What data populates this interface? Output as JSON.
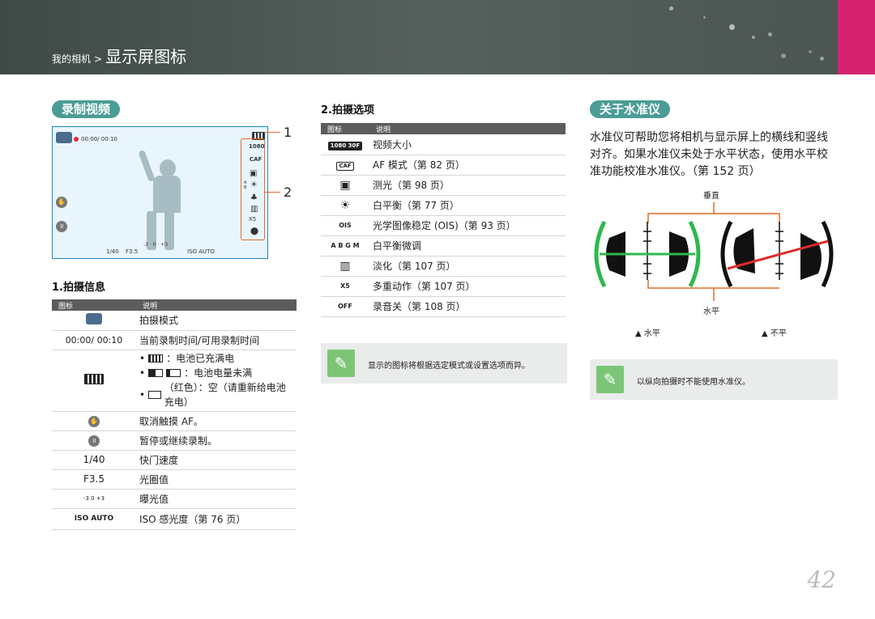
{
  "breadcrumb": {
    "parent": "我的相机",
    "sep": ">",
    "current": "显示屏图标"
  },
  "left": {
    "pill": "录制视频",
    "screen": {
      "time": "00:00/ 00:10",
      "shutter": "1/40",
      "aperture": "F3.5",
      "iso": "ISO AUTO"
    },
    "callouts": [
      "1",
      "2"
    ],
    "section_title": "1.拍摄信息",
    "table_headers": [
      "图标",
      "说明"
    ],
    "rows": [
      {
        "icon": "smart-mode-icon",
        "desc": "拍摄模式"
      },
      {
        "icon_text": "00:00/ 00:10",
        "desc": "当前录制时间/可用录制时间"
      },
      {
        "icon": "battery-icon",
        "bullets": [
          {
            "sym": "full",
            "text": "：电池已充满电"
          },
          {
            "sym": "half",
            "text": "：电池电量未满"
          },
          {
            "sym": "empty",
            "text": "（红色）：空（请重新给电池充电）"
          }
        ]
      },
      {
        "icon": "touch-af-icon",
        "desc": "取消触摸 AF。"
      },
      {
        "icon": "pause-icon",
        "desc": "暂停或继续录制。"
      },
      {
        "icon_text": "1/40",
        "desc": "快门速度"
      },
      {
        "icon_text": "F3.5",
        "desc": "光圈值"
      },
      {
        "icon_text": "-3 0 +3",
        "desc": "曝光值"
      },
      {
        "icon_text": "ISO AUTO",
        "desc": "ISO 感光度（第 76 页）"
      }
    ]
  },
  "middle": {
    "section_title": "2.拍摄选项",
    "table_headers": [
      "图标",
      "说明"
    ],
    "rows": [
      {
        "icon": "movie-size-icon",
        "icon_text": "1080 30F",
        "desc": "视频大小"
      },
      {
        "icon": "af-mode-icon",
        "icon_text": "CAF",
        "desc": "AF 模式（第 82 页）"
      },
      {
        "icon": "metering-icon",
        "icon_text": "▣",
        "desc": "测光（第 98 页）"
      },
      {
        "icon": "white-balance-icon",
        "icon_text": "☀",
        "desc": "白平衡（第 77 页）"
      },
      {
        "icon": "ois-icon",
        "icon_text": "OIS",
        "desc": "光学图像稳定 (OIS)（第 93 页）"
      },
      {
        "icon": "wb-fine-tune-icon",
        "icon_text": "A B G M",
        "desc": "白平衡微调"
      },
      {
        "icon": "fade-icon",
        "icon_text": "▥",
        "desc": "淡化（第 107 页）"
      },
      {
        "icon": "multi-motion-icon",
        "icon_text": "X5",
        "desc": "多重动作（第 107 页）"
      },
      {
        "icon": "voice-off-icon",
        "icon_text": "OFF",
        "desc": "录音关（第 108 页）"
      }
    ],
    "note": "显示的图标将根据选定模式或设置选项而异。"
  },
  "right": {
    "pill": "关于水准仪",
    "description": "水准仪可帮助您将相机与显示屏上的横线和竖线对齐。如果水准仪未处于水平状态，使用水平校准功能校准水准仪。（第 152 页）",
    "label_vertical": "垂直",
    "label_horizontal": "水平",
    "caption_level": "▲ 水平",
    "caption_not_level": "▲ 不平",
    "note": "以纵向拍摄时不能使用水准仪。"
  },
  "page_number": "42",
  "colors": {
    "teal": "#4a9c96",
    "green": "#2eb84b",
    "red": "#e02a2a",
    "orange": "#e86b2a",
    "pink": "#d4226f"
  }
}
